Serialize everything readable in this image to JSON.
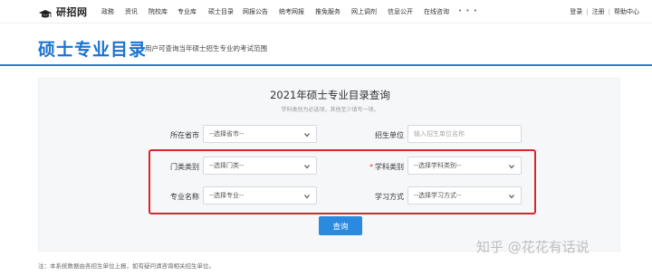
{
  "topbar": {
    "logo_text": "研招网",
    "nav_items": [
      "政務",
      "资讯",
      "院校库",
      "专业库",
      "硕士目录",
      "网报公告",
      "统考网报",
      "推免服务",
      "网上调剂",
      "信息公开",
      "在线咨询"
    ],
    "more_label": "• • •",
    "login_label": "登录",
    "register_label": "注册",
    "help_label": "帮助中心",
    "separator": "|"
  },
  "header": {
    "title": "硕士专业目录",
    "subtitle": "用户可查询当年硕士招生专业的考试范围"
  },
  "panel": {
    "title": "2021年硕士专业目录查询",
    "note": "学科类别为必选项，其他至少填写一项。"
  },
  "form": {
    "province": {
      "label": "所在省市",
      "value": "--选择省市--"
    },
    "unit": {
      "label": "招生单位",
      "placeholder": "输入招生单位名称"
    },
    "category": {
      "label": "门类类别",
      "value": "--选择门类--"
    },
    "discipline": {
      "required_mark": "*",
      "label": "学科类别",
      "value": "--选择学科类别--"
    },
    "major": {
      "label": "专业名称",
      "value": "--选择专业--"
    },
    "study_mode": {
      "label": "学习方式",
      "value": "--选择学习方式--"
    },
    "search_button": "查询"
  },
  "footnote": "注：本系统数据由各招生单位上报，如有疑问请咨询相关招生单位。",
  "watermark": "知乎 @花花有话说",
  "colors": {
    "accent": "#1a73d0",
    "button": "#2a8ae0",
    "highlight_box": "#d8262c"
  }
}
